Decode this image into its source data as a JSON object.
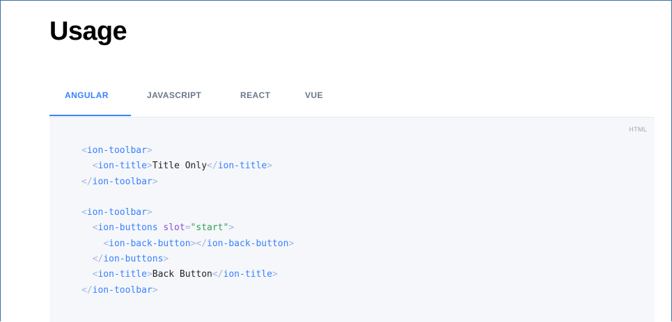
{
  "page": {
    "title": "Usage"
  },
  "tabs": [
    {
      "label": "ANGULAR",
      "active": true
    },
    {
      "label": "JAVASCRIPT",
      "active": false
    },
    {
      "label": "REACT",
      "active": false
    },
    {
      "label": "VUE",
      "active": false
    }
  ],
  "code": {
    "language_label": "HTML",
    "lines": [
      {
        "indent": "",
        "parts": [
          [
            "punct",
            "<"
          ],
          [
            "tag",
            "ion-toolbar"
          ],
          [
            "punct",
            ">"
          ]
        ]
      },
      {
        "indent": "  ",
        "parts": [
          [
            "punct",
            "<"
          ],
          [
            "tag",
            "ion-title"
          ],
          [
            "punct",
            ">"
          ],
          [
            "txt",
            "Title Only"
          ],
          [
            "punct",
            "</"
          ],
          [
            "tag",
            "ion-title"
          ],
          [
            "punct",
            ">"
          ]
        ]
      },
      {
        "indent": "",
        "parts": [
          [
            "punct",
            "</"
          ],
          [
            "tag",
            "ion-toolbar"
          ],
          [
            "punct",
            ">"
          ]
        ]
      },
      {
        "indent": "",
        "parts": []
      },
      {
        "indent": "",
        "parts": [
          [
            "punct",
            "<"
          ],
          [
            "tag",
            "ion-toolbar"
          ],
          [
            "punct",
            ">"
          ]
        ]
      },
      {
        "indent": "  ",
        "parts": [
          [
            "punct",
            "<"
          ],
          [
            "tag",
            "ion-buttons"
          ],
          [
            "txt",
            " "
          ],
          [
            "attr",
            "slot"
          ],
          [
            "punct",
            "="
          ],
          [
            "str",
            "\"start\""
          ],
          [
            "punct",
            ">"
          ]
        ]
      },
      {
        "indent": "    ",
        "parts": [
          [
            "punct",
            "<"
          ],
          [
            "tag",
            "ion-back-button"
          ],
          [
            "punct",
            ">"
          ],
          [
            "punct",
            "</"
          ],
          [
            "tag",
            "ion-back-button"
          ],
          [
            "punct",
            ">"
          ]
        ]
      },
      {
        "indent": "  ",
        "parts": [
          [
            "punct",
            "</"
          ],
          [
            "tag",
            "ion-buttons"
          ],
          [
            "punct",
            ">"
          ]
        ]
      },
      {
        "indent": "  ",
        "parts": [
          [
            "punct",
            "<"
          ],
          [
            "tag",
            "ion-title"
          ],
          [
            "punct",
            ">"
          ],
          [
            "txt",
            "Back Button"
          ],
          [
            "punct",
            "</"
          ],
          [
            "tag",
            "ion-title"
          ],
          [
            "punct",
            ">"
          ]
        ]
      },
      {
        "indent": "",
        "parts": [
          [
            "punct",
            "</"
          ],
          [
            "tag",
            "ion-toolbar"
          ],
          [
            "punct",
            ">"
          ]
        ]
      }
    ]
  },
  "colors": {
    "accent": "#3880ff",
    "tab_inactive": "#6b7889",
    "code_background": "#f5f7fa",
    "frame_border": "#3d6fa8"
  }
}
